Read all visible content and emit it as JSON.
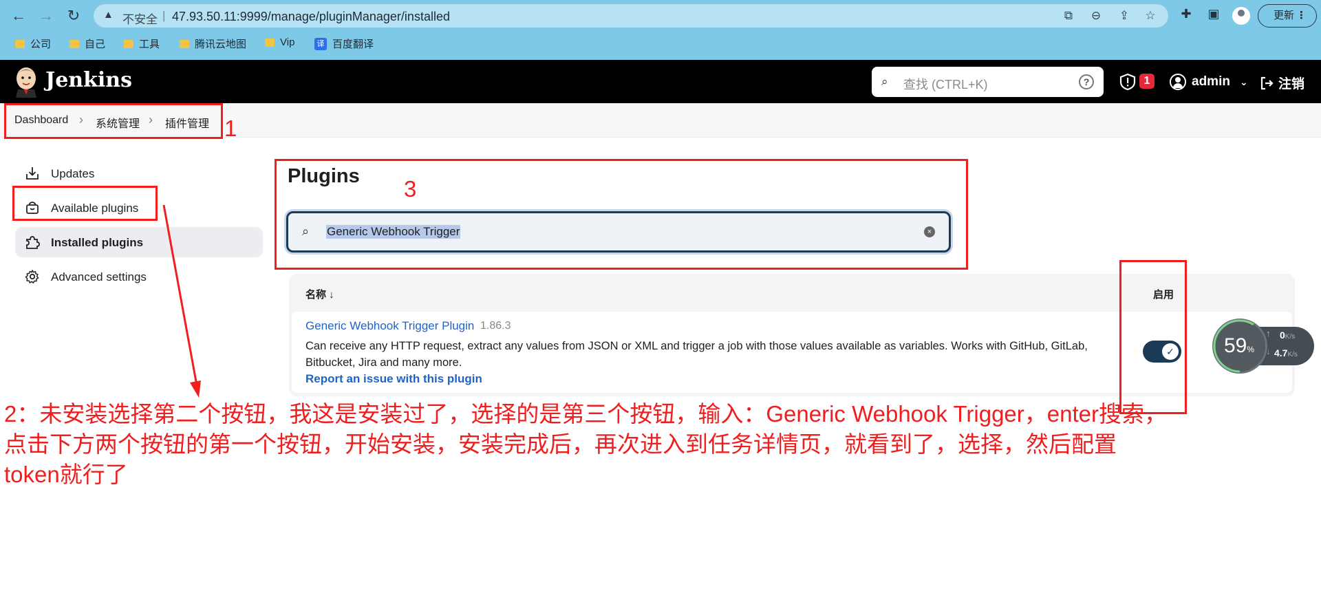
{
  "browser": {
    "insecure_label": "不安全",
    "separator": "|",
    "url": "47.93.50.11:9999/manage/pluginManager/installed",
    "update_button": "更新",
    "bookmarks": [
      {
        "label": "公司"
      },
      {
        "label": "自己"
      },
      {
        "label": "工具"
      },
      {
        "label": "腾讯云地图"
      },
      {
        "label": "Vip"
      },
      {
        "label": "百度翻译"
      }
    ]
  },
  "header": {
    "brand": "Jenkins",
    "search_placeholder": "查找 (CTRL+K)",
    "help_glyph": "?",
    "security_count": "1",
    "user": "admin",
    "logout": "注销"
  },
  "breadcrumb": {
    "items": [
      "Dashboard",
      "系统管理",
      "插件管理"
    ]
  },
  "sidebar": {
    "items": [
      {
        "label": "Updates",
        "active": false
      },
      {
        "label": "Available plugins",
        "active": false
      },
      {
        "label": "Installed plugins",
        "active": true
      },
      {
        "label": "Advanced settings",
        "active": false
      }
    ]
  },
  "main": {
    "title": "Plugins",
    "search_value": "Generic Webhook Trigger",
    "table": {
      "col_name": "名称 ↓",
      "col_enabled": "启用",
      "rows": [
        {
          "name": "Generic Webhook Trigger Plugin",
          "version": "1.86.3",
          "description": "Can receive any HTTP request, extract any values from JSON or XML and trigger a job with those values available as variables. Works with GitHub, GitLab, Bitbucket, Jira and many more.",
          "report_link": "Report an issue with this plugin",
          "enabled": true
        }
      ]
    }
  },
  "annotations": {
    "label_1": "1",
    "label_3": "3",
    "note": "2：未安装选择第二个按钮，我这是安装过了，选择的是第三个按钮，输入：Generic Webhook Trigger，enter搜索，点击下方两个按钮的第一个按钮，开始安装，安装完成后，再次进入到任务详情页，就看到了，选择，然后配置token就行了",
    "color": "#f01e1e"
  },
  "net_widget": {
    "percent": "59",
    "percent_unit": "%",
    "up": "0",
    "down": "4.7",
    "unit": "K/s"
  }
}
